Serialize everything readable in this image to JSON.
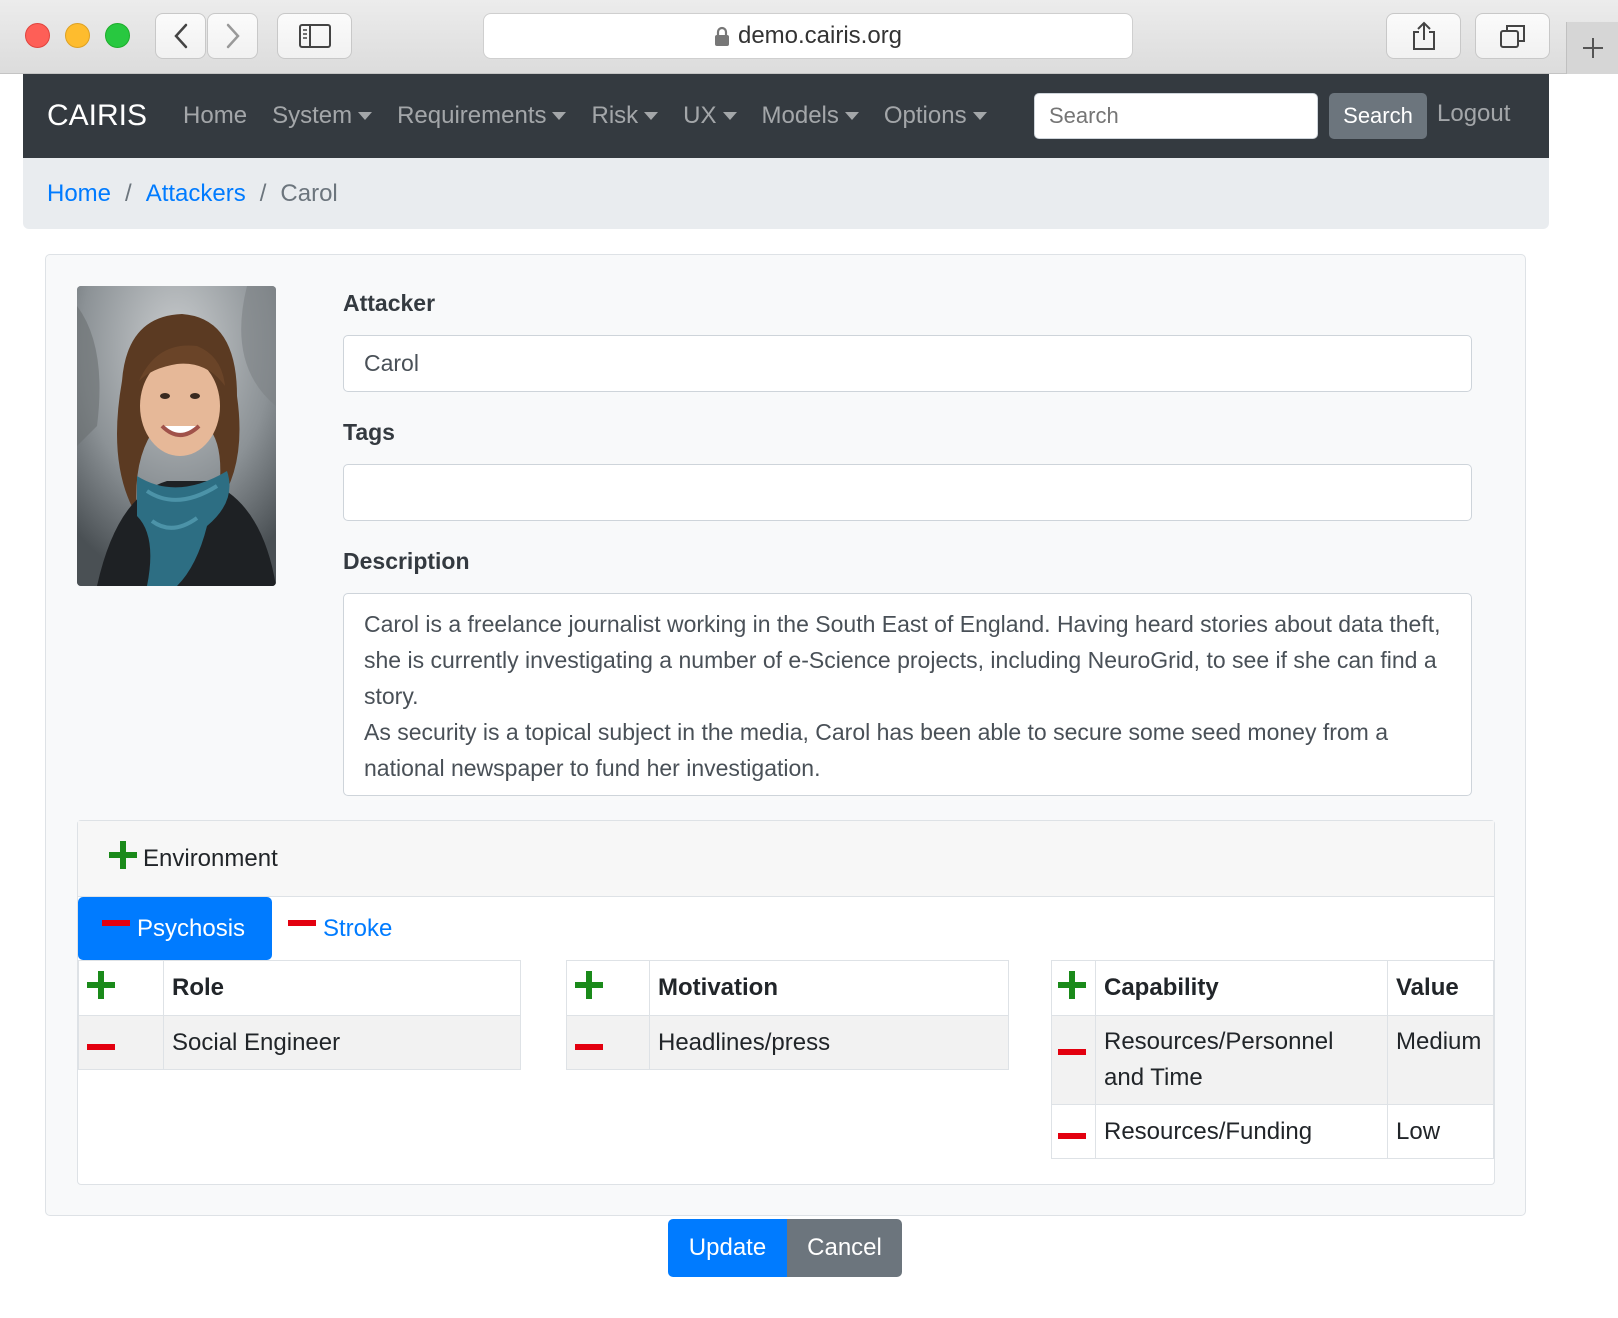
{
  "browser": {
    "url": "demo.cairis.org"
  },
  "navbar": {
    "brand": "CAIRIS",
    "items": [
      {
        "label": "Home",
        "dropdown": false
      },
      {
        "label": "System",
        "dropdown": true
      },
      {
        "label": "Requirements",
        "dropdown": true
      },
      {
        "label": "Risk",
        "dropdown": true
      },
      {
        "label": "UX",
        "dropdown": true
      },
      {
        "label": "Models",
        "dropdown": true
      },
      {
        "label": "Options",
        "dropdown": true
      }
    ],
    "search_placeholder": "Search",
    "search_button": "Search",
    "logout": "Logout"
  },
  "breadcrumb": {
    "home": "Home",
    "section": "Attackers",
    "current": "Carol",
    "separator": "/"
  },
  "form": {
    "attacker_label": "Attacker",
    "attacker_value": "Carol",
    "tags_label": "Tags",
    "tags_value": "",
    "description_label": "Description",
    "description_p1": "Carol is a freelance journalist working in the South East of England.  Having heard stories about data theft, she is currently investigating a number of e-Science projects, including NeuroGrid, to see if she can find a story.",
    "description_p2": "As security is a topical subject in the media, Carol has been able to secure some seed money from a national newspaper to fund her investigation."
  },
  "environment": {
    "header_label": "Environment",
    "tabs": [
      {
        "label": "Psychosis",
        "active": true
      },
      {
        "label": "Stroke",
        "active": false
      }
    ],
    "roles": {
      "header": "Role",
      "rows": [
        "Social Engineer"
      ]
    },
    "motivations": {
      "header": "Motivation",
      "rows": [
        "Headlines/press"
      ]
    },
    "capabilities": {
      "header_capability": "Capability",
      "header_value": "Value",
      "rows": [
        {
          "capability": "Resources/Personnel and Time",
          "value": "Medium"
        },
        {
          "capability": "Resources/Funding",
          "value": "Low"
        }
      ]
    }
  },
  "actions": {
    "update": "Update",
    "cancel": "Cancel"
  },
  "colors": {
    "navbar_bg": "#343a40",
    "primary": "#007bff",
    "secondary": "#6c757d",
    "add_icon": "#1a8a1a",
    "remove_icon": "#e3000f"
  }
}
